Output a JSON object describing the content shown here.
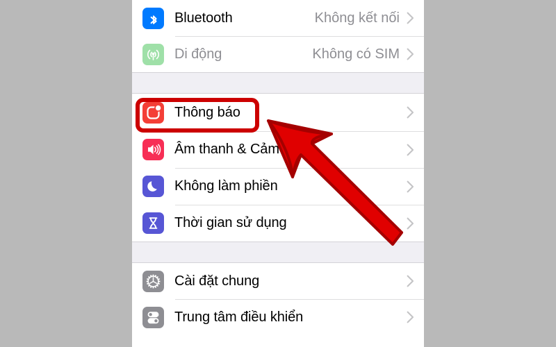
{
  "screen": {
    "background_color": "#b9b9b9",
    "phone_background_color": "#ffffff"
  },
  "settings_list": {
    "groups": [
      {
        "name": "connectivity-group",
        "rows": [
          {
            "name": "bluetooth",
            "label": "Bluetooth",
            "value": "Không kết nối",
            "icon": "bluetooth-icon",
            "icon_color": "#007aff",
            "dimmed": false,
            "chevron": true
          },
          {
            "name": "cellular",
            "label": "Di động",
            "value": "Không có SIM",
            "icon": "cellular-antenna-icon",
            "icon_color": "#9fe0a8",
            "dimmed": true,
            "chevron": true
          }
        ]
      },
      {
        "name": "notifications-group",
        "rows": [
          {
            "name": "notifications",
            "label": "Thông báo",
            "value": "",
            "icon": "notification-badge-icon",
            "icon_color": "#f43f37",
            "dimmed": false,
            "chevron": true
          },
          {
            "name": "sounds-haptics",
            "label": "Âm thanh & Cảm",
            "value": "",
            "icon": "speaker-icon",
            "icon_color": "#f72e55",
            "dimmed": false,
            "chevron": true
          },
          {
            "name": "do-not-disturb",
            "label": "Không làm phiền",
            "value": "",
            "icon": "moon-icon",
            "icon_color": "#5756d5",
            "dimmed": false,
            "chevron": true
          },
          {
            "name": "screen-time",
            "label": "Thời gian sử dụng",
            "value": "",
            "icon": "hourglass-icon",
            "icon_color": "#5756d5",
            "dimmed": false,
            "chevron": true
          }
        ]
      },
      {
        "name": "system-group",
        "rows": [
          {
            "name": "general",
            "label": "Cài đặt chung",
            "value": "",
            "icon": "gear-icon",
            "icon_color": "#8e8e93",
            "dimmed": false,
            "chevron": true
          },
          {
            "name": "control-center",
            "label": "Trung tâm điều khiển",
            "value": "",
            "icon": "toggles-icon",
            "icon_color": "#8e8e93",
            "dimmed": false,
            "chevron": true
          }
        ]
      }
    ]
  },
  "annotations": {
    "highlight_box": {
      "name": "notifications-highlight-box",
      "color": "#cc0000"
    },
    "arrow": {
      "name": "pointer-arrow",
      "fill_color": "#e00000",
      "stroke_color": "#a50000",
      "points_to": "Thông báo"
    }
  }
}
